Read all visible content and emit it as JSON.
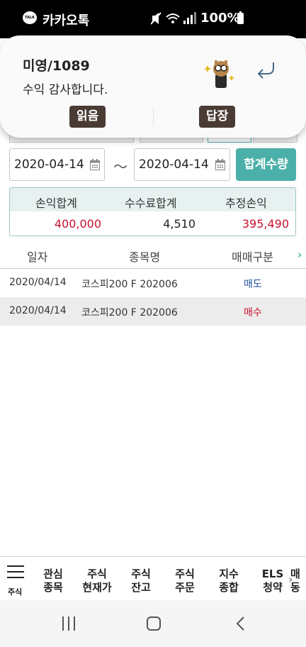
{
  "status_bar": {
    "app_name": "카카오톡",
    "battery": "100%"
  },
  "notification": {
    "sender": "미영/1089",
    "message": "수익 감사합니다.",
    "read_label": "읽음",
    "reply_label": "답장"
  },
  "query": {
    "start_date": "2020-04-14",
    "separator": "～",
    "end_date": "2020-04-14",
    "sum_button": "합계수량"
  },
  "summary": {
    "headers": [
      "손익합계",
      "수수료합계",
      "추정손익"
    ],
    "values": [
      "400,000",
      "4,510",
      "395,490"
    ],
    "colors": {
      "profit": "#c8102e",
      "neutral": "#222222"
    }
  },
  "table": {
    "headers": [
      "일자",
      "종목명",
      "매매구분"
    ],
    "rows": [
      {
        "date": "2020/04/14",
        "name": "코스피200 F 202006",
        "side": "매도",
        "side_color": "#1f4e9c"
      },
      {
        "date": "2020/04/14",
        "name": "코스피200 F 202006",
        "side": "매수",
        "side_color": "#c8102e"
      }
    ]
  },
  "bottom_nav": {
    "menu_label": "주식",
    "items": [
      [
        "관심",
        "종목"
      ],
      [
        "주식",
        "현재가"
      ],
      [
        "주식",
        "잔고"
      ],
      [
        "주식",
        "주문"
      ],
      [
        "지수",
        "종합"
      ],
      [
        "ELS",
        "청약"
      ],
      [
        "매",
        "동"
      ]
    ]
  },
  "accent_color": "#4bb0a9"
}
